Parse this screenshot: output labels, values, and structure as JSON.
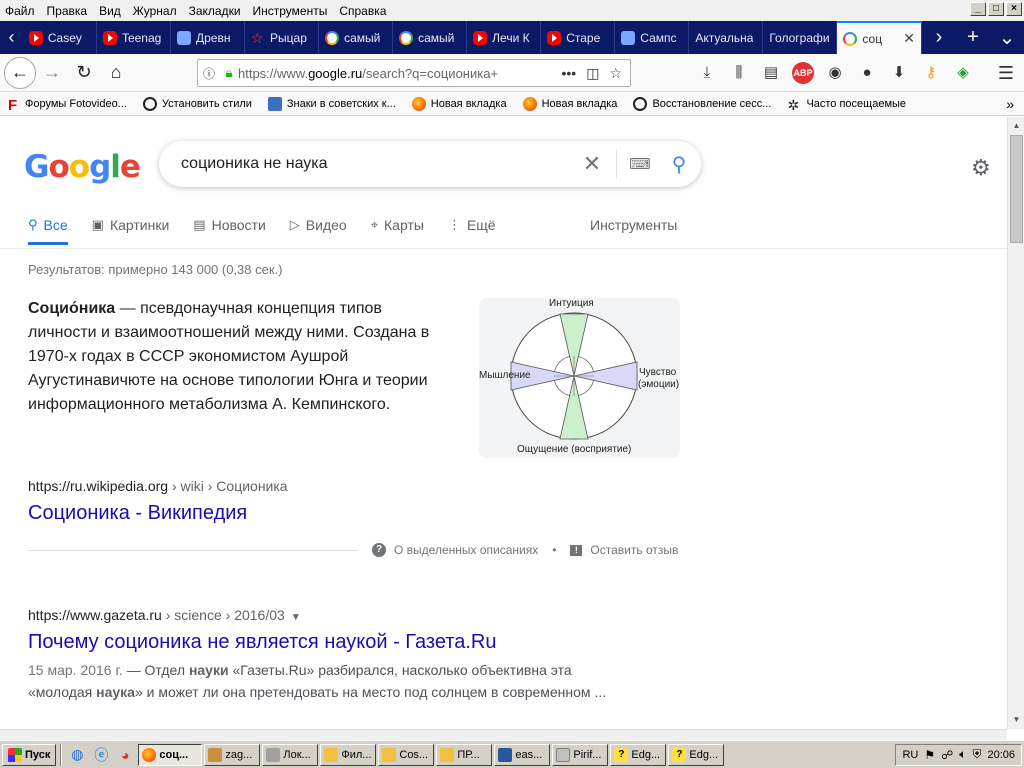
{
  "menubar": {
    "items": [
      "Файл",
      "Правка",
      "Вид",
      "Журнал",
      "Закладки",
      "Инструменты",
      "Справка"
    ]
  },
  "tabs": [
    {
      "label": "Casey",
      "icon": "youtube-icon"
    },
    {
      "label": "Teenag",
      "icon": "youtube-icon"
    },
    {
      "label": "Древн",
      "icon": "image-icon"
    },
    {
      "label": "Рыцар",
      "icon": "star-icon"
    },
    {
      "label": "самый",
      "icon": "google-icon"
    },
    {
      "label": "самый",
      "icon": "google-icon"
    },
    {
      "label": "Лечи К",
      "icon": "youtube-icon"
    },
    {
      "label": "Старе",
      "icon": "youtube-icon"
    },
    {
      "label": "Сампс",
      "icon": "book-icon"
    },
    {
      "label": "Актуальна",
      "icon": ""
    },
    {
      "label": "Голографи",
      "icon": ""
    },
    {
      "label": "соц",
      "icon": "google-icon",
      "active": true
    }
  ],
  "address": {
    "url_prefix": "https://www.",
    "url_domain": "google.ru",
    "url_rest": "/search?q=соционика+"
  },
  "bookmarks": [
    {
      "label": "Форумы Fotovideo...",
      "icon": "fotovideo-icon"
    },
    {
      "label": "Установить стили",
      "icon": "globe-icon"
    },
    {
      "label": "Знаки в советских к...",
      "icon": "bookmark-icon"
    },
    {
      "label": "Новая вкладка",
      "icon": "firefox-icon"
    },
    {
      "label": "Новая вкладка",
      "icon": "firefox-icon"
    },
    {
      "label": "Восстановление сесс...",
      "icon": "globe-icon"
    },
    {
      "label": "Часто посещаемые",
      "icon": "gear-icon"
    }
  ],
  "google": {
    "query": "соционика не наука",
    "tabs": [
      {
        "label": "Все",
        "icon": "search-icon",
        "active": true
      },
      {
        "label": "Картинки",
        "icon": "image-icon"
      },
      {
        "label": "Новости",
        "icon": "news-icon"
      },
      {
        "label": "Видео",
        "icon": "play-icon"
      },
      {
        "label": "Карты",
        "icon": "pin-icon"
      },
      {
        "label": "Ещё",
        "icon": "more-icon"
      }
    ],
    "tools_label": "Инструменты",
    "stats": "Результатов: примерно 143 000 (0,38 сек.)"
  },
  "featured": {
    "term": "Социо́ника",
    "text": " — псевдонаучная концепция типов личности и взаимоотношений между ними. Создана в 1970-х годах в СССР экономистом Аушрой Аугустинавичюте на основе типологии Юнга и теории информационного метаболизма А. Кемпинского.",
    "diagram": {
      "top": "Интуиция",
      "left": "Мышление",
      "right_line1": "Чувство",
      "right_line2": "(эмоции)",
      "bottom": "Ощущение (восприятие)"
    },
    "url_host": "https://ru.wikipedia.org",
    "url_crumbs": " › wiki › Соционика",
    "title": "Соционика - Википедия",
    "about_label": "О выделенных описаниях",
    "feedback_label": "Оставить отзыв"
  },
  "result2": {
    "url_host": "https://www.gazeta.ru",
    "url_crumbs": " › science › 2016/03",
    "title": "Почему соционика не является наукой - Газета.Ru",
    "date": "15 мар. 2016 г.",
    "d1": " — Отдел ",
    "d1b": "науки",
    "d2": " «Газеты.Ru» разбирался, насколько объективна эта",
    "d3": "«молодая ",
    "d3b": "наука",
    "d4": "» и может ли она претендовать на место под солнцем в современном ..."
  },
  "taskbar": {
    "start_label": "Пуск",
    "items": [
      {
        "label": "соц...",
        "icon": "firefox-icon",
        "active": true
      },
      {
        "label": "zag...",
        "icon": "archive-icon"
      },
      {
        "label": "Лок...",
        "icon": "drive-icon"
      },
      {
        "label": "Фил...",
        "icon": "folder-icon"
      },
      {
        "label": "Cos...",
        "icon": "folder-icon"
      },
      {
        "label": "ПР...",
        "icon": "folder-icon"
      },
      {
        "label": "eas...",
        "icon": "document-icon"
      },
      {
        "label": "Pirif...",
        "icon": "app-icon"
      },
      {
        "label": "Edg...",
        "icon": "help-icon"
      },
      {
        "label": "Edg...",
        "icon": "help-icon"
      }
    ],
    "lang": "RU",
    "time": "20:06"
  }
}
